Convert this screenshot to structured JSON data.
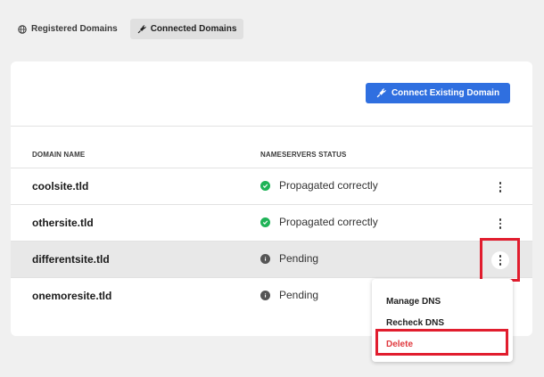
{
  "tabs": [
    {
      "label": "Registered Domains",
      "icon": "globe-icon",
      "active": false
    },
    {
      "label": "Connected Domains",
      "icon": "plug-icon",
      "active": true
    }
  ],
  "toolbar": {
    "connect_label": "Connect Existing Domain"
  },
  "table": {
    "headers": {
      "domain": "DOMAIN NAME",
      "status": "NAMESERVERS STATUS"
    },
    "rows": [
      {
        "domain": "coolsite.tld",
        "status": "Propagated correctly",
        "state": "ok"
      },
      {
        "domain": "othersite.tld",
        "status": "Propagated correctly",
        "state": "ok"
      },
      {
        "domain": "differentsite.tld",
        "status": "Pending",
        "state": "pending"
      },
      {
        "domain": "onemoresite.tld",
        "status": "Pending",
        "state": "pending"
      }
    ]
  },
  "menu": {
    "items": [
      {
        "label": "Manage DNS"
      },
      {
        "label": "Recheck DNS"
      },
      {
        "label": "Delete"
      }
    ]
  },
  "colors": {
    "accent": "#2f6fe0",
    "ok": "#1fb357",
    "danger": "#e0393e",
    "highlight": "#e11d2e"
  }
}
